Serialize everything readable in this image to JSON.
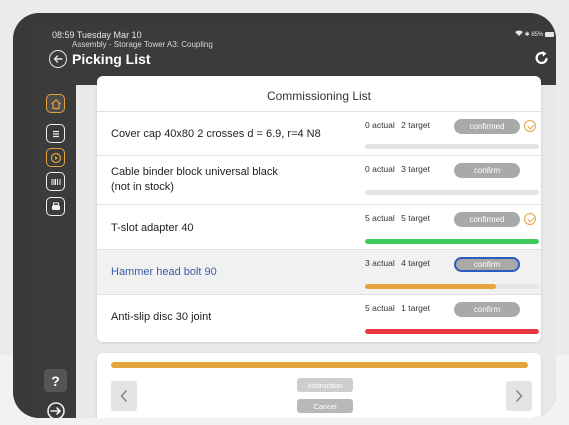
{
  "status_bar": {
    "time": "08:59",
    "date": "Tuesday Mar 10",
    "right": "85%"
  },
  "header": {
    "breadcrumb": "Assembly - Storage Tower A3: Coupling",
    "title": "Picking List"
  },
  "list": {
    "title": "Commissioning List",
    "items": [
      {
        "name": "Cover cap 40x80 2 crosses d = 6.9, r=4 N8",
        "name2": "",
        "actual": "0 actual",
        "target": "2 target",
        "button": "confirmed",
        "confirmed": true,
        "progress": 0,
        "bar_color": "#e4a43c"
      },
      {
        "name": "Cable binder block universal black",
        "name2": "(not in stock)",
        "actual": "0 actual",
        "target": "3 target",
        "button": "confirm",
        "confirmed": false,
        "progress": 0,
        "bar_color": "#e4a43c"
      },
      {
        "name": "T-slot adapter 40",
        "name2": "",
        "actual": "5 actual",
        "target": "5 target",
        "button": "confirmed",
        "confirmed": true,
        "progress": 1.0,
        "bar_color": "#3dcc5a"
      },
      {
        "name": "Hammer head bolt 90",
        "name2": "",
        "actual": "3 actual",
        "target": "4 target",
        "button": "confirm",
        "confirmed": false,
        "selected": true,
        "progress": 0.75,
        "bar_color": "#e4a43c"
      },
      {
        "name": "Anti-slip disc 30 joint",
        "name2": "",
        "actual": "5 actual",
        "target": "1 target",
        "button": "confirm",
        "confirmed": false,
        "progress": 1.0,
        "bar_color": "#e8363d"
      }
    ]
  },
  "bottom": {
    "total_progress": 1.0,
    "instruction_label": "Instruction",
    "cancel_label": "Cancel"
  },
  "sidebar": {
    "help_label": "?"
  },
  "colors": {
    "accent": "#e4a43c",
    "selected_border": "#2c5dbd",
    "topbar": "#3b3b3b"
  }
}
